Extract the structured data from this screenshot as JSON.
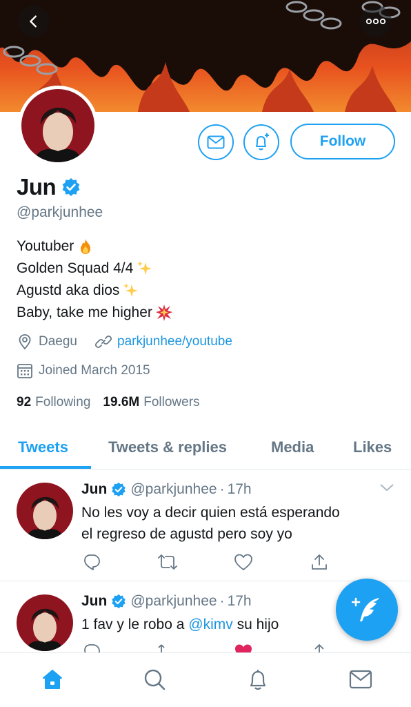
{
  "header": {
    "back_icon": "chevron-left-icon",
    "more_icon": "more-horizontal-icon"
  },
  "profile": {
    "name": "Jun",
    "handle": "@parkjunhee",
    "verified": true,
    "bio": [
      {
        "text": "Youtuber",
        "emoji": "fire"
      },
      {
        "text": "Golden Squad 4/4",
        "emoji": "sparkles"
      },
      {
        "text": "Agustd aka dios",
        "emoji": "sparkles"
      },
      {
        "text": "Baby, take me higher",
        "emoji": "collision"
      }
    ],
    "location": "Daegu",
    "website": "parkjunhee/youtube",
    "joined": "Joined March 2015",
    "following_count": "92",
    "following_label": "Following",
    "followers_count": "19.6M",
    "followers_label": "Followers"
  },
  "actions": {
    "follow_label": "Follow",
    "message_icon": "envelope-icon",
    "notify_icon": "bell-plus-icon"
  },
  "tabs": [
    {
      "label": "Tweets",
      "active": true
    },
    {
      "label": "Tweets & replies",
      "active": false
    },
    {
      "label": "Media",
      "active": false
    },
    {
      "label": "Likes",
      "active": false
    }
  ],
  "tweets": [
    {
      "name": "Jun",
      "handle": "@parkjunhee",
      "time": "17h",
      "dot": "·",
      "text_line1": "No les voy a decir quien está esperando",
      "text_line2": "el regreso de agustd pero soy yo"
    },
    {
      "name": "Jun",
      "handle": "@parkjunhee",
      "time": "17h",
      "dot": "·",
      "text_before": "1 fav y le robo a ",
      "mention": "@kimv",
      "text_after": " su hijo"
    }
  ],
  "bottom_nav": [
    "home-icon",
    "search-icon",
    "notifications-icon",
    "messages-icon"
  ],
  "colors": {
    "accent": "#1da1f2",
    "text": "#14171a",
    "secondary": "#657786",
    "like_red": "#e0245e"
  }
}
